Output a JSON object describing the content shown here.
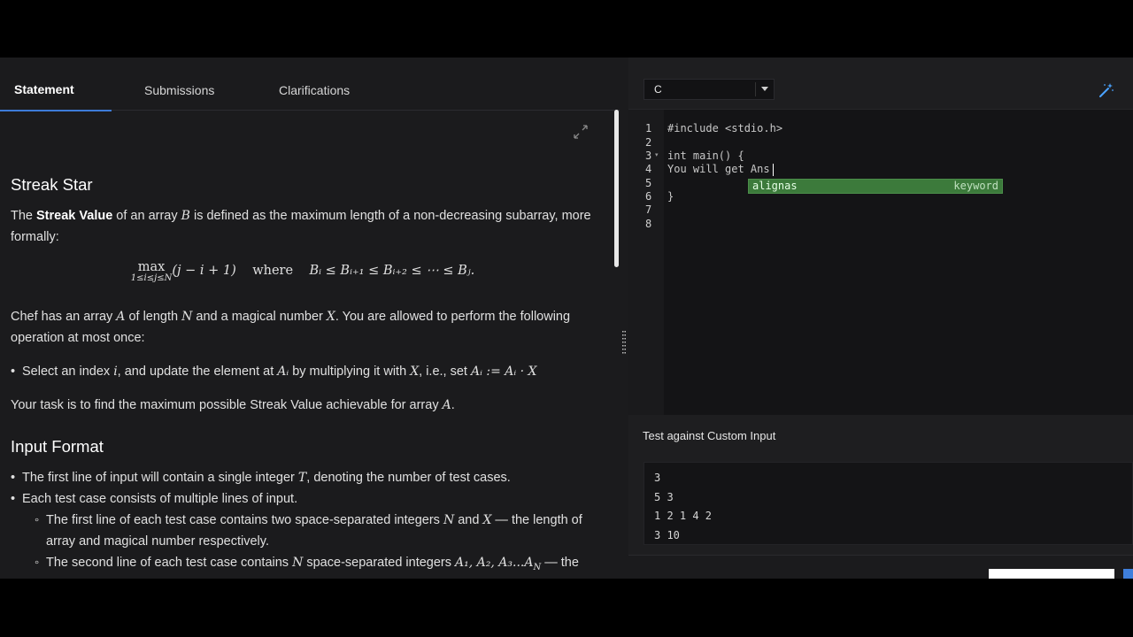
{
  "tabs": {
    "statement": "Statement",
    "submissions": "Submissions",
    "clarifications": "Clarifications"
  },
  "problem": {
    "title": "Streak Star",
    "p1_a": "The ",
    "p1_bold": "Streak Value",
    "p1_b": " of an array ",
    "p1_var": "B",
    "p1_c": " is defined as the maximum length of a non-decreasing subarray, more formally:",
    "formula_max": "max",
    "formula_sub": "1≤i≤j≤N",
    "formula_body": "(j − i + 1)",
    "formula_where": "where",
    "formula_cond": "Bᵢ ≤ Bᵢ₊₁ ≤ Bᵢ₊₂ ≤ ⋯ ≤ Bⱼ.",
    "p2_a": "Chef has an array ",
    "p2_var_a": "A",
    "p2_b": " of length ",
    "p2_var_n": "N",
    "p2_c": " and a magical number ",
    "p2_var_x": "X",
    "p2_d": ". You are allowed to perform the following operation at most once:",
    "op_a": "Select an index ",
    "op_var_i": "i",
    "op_b": ", and update the element at ",
    "op_var_ai": "Aᵢ",
    "op_c": " by multiplying it with ",
    "op_var_x": "X",
    "op_d": ", i.e., set ",
    "op_expr": "Aᵢ := Aᵢ · X",
    "task_a": "Your task is to find the maximum possible Streak Value achievable for array ",
    "task_var": "A",
    "task_b": ".",
    "input_heading": "Input Format",
    "in1_a": "The first line of input will contain a single integer ",
    "in1_var": "T",
    "in1_b": ", denoting the number of test cases.",
    "in2": "Each test case consists of multiple lines of input.",
    "in2a_a": "The first line of each test case contains two space-separated integers ",
    "in2a_n": "N",
    "in2a_and": " and ",
    "in2a_x": "X",
    "in2a_b": " — the length of array and magical number respectively.",
    "in2b_a": "The second line of each test case contains ",
    "in2b_n": "N",
    "in2b_b": " space-separated integers ",
    "in2b_seq": "A₁, A₂, A₃...A",
    "in2b_seq_sub": "N",
    "in2b_c": " — the elements of the array."
  },
  "editor": {
    "language": "C",
    "lines": [
      "#include <stdio.h>",
      "",
      "int main() {",
      "You will get Ans",
      "",
      "}",
      "",
      ""
    ],
    "line_numbers": [
      "1",
      "2",
      "3",
      "4",
      "5",
      "6",
      "7",
      "8"
    ],
    "autocomplete": {
      "word": "alignas",
      "kind": "keyword"
    }
  },
  "custom_input": {
    "title": "Test against Custom Input",
    "lines": [
      "3",
      "5 3",
      "1 2 1 4 2",
      "3 10"
    ]
  },
  "colors": {
    "accent_blue": "#3d7bd8",
    "autocomplete_green": "#3c7a3b",
    "wand_blue": "#4aa3ff"
  },
  "icons": {
    "fullscreen": "expand-icon",
    "wand": "magic-wand-icon",
    "caret": "chevron-down-icon"
  }
}
